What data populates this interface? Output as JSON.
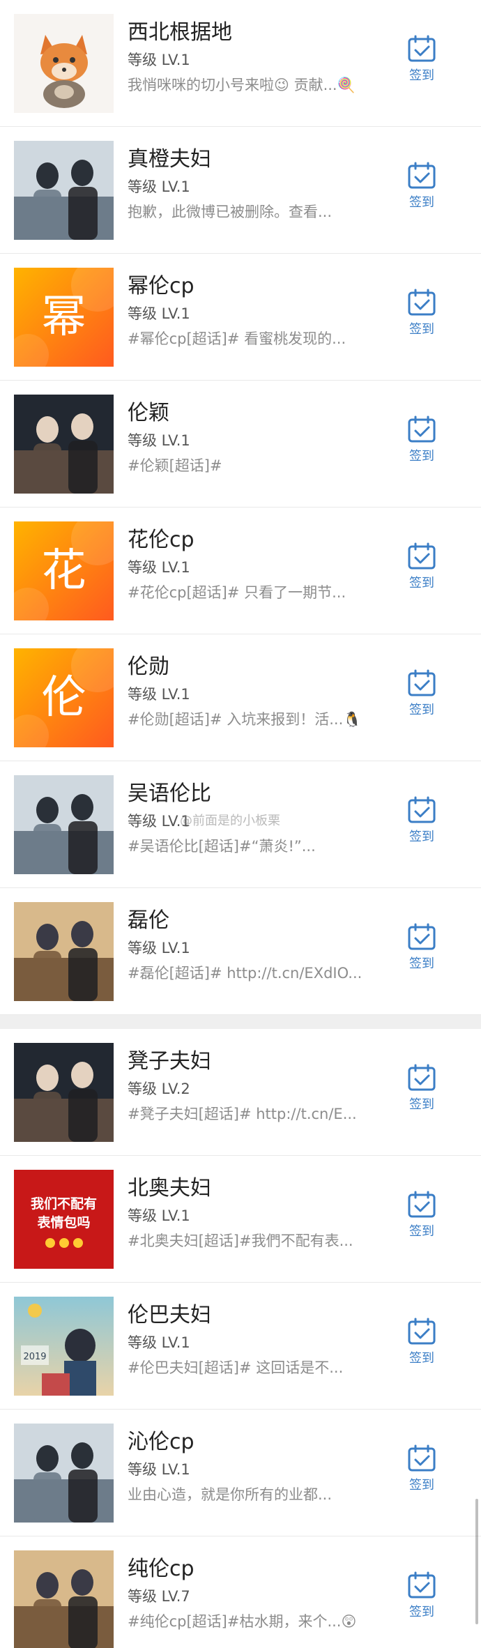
{
  "checkin_label": "签到",
  "watermark": "@前面是的小板栗",
  "icons": {
    "checkin": "calendar-check-icon"
  },
  "colors": {
    "accent": "#3b7ec6",
    "orange": "#f56a1b"
  },
  "groups": [
    [
      {
        "name": "西北根据地",
        "level": "等级 LV.1",
        "desc": "我悄咪咪的切小号来啦😉 贡献...🍭",
        "thumb_kind": "cartoon"
      },
      {
        "name": "真橙夫妇",
        "level": "等级 LV.1",
        "desc": "抱歉，此微博已被删除。查看...",
        "thumb_kind": "photo"
      },
      {
        "name": "幂伦cp",
        "level": "等级 LV.1",
        "desc": "#幂伦cp[超话]# 看蜜桃发现的...",
        "thumb_kind": "char",
        "thumb_char": "幂"
      },
      {
        "name": "伦颖",
        "level": "等级 LV.1",
        "desc": "#伦颖[超话]#",
        "thumb_kind": "photo"
      },
      {
        "name": "花伦cp",
        "level": "等级 LV.1",
        "desc": "#花伦cp[超话]# 只看了一期节...",
        "thumb_kind": "char",
        "thumb_char": "花"
      },
      {
        "name": "伦勋",
        "level": "等级 LV.1",
        "desc": "#伦勋[超话]# 入坑来报到！活...🐧",
        "thumb_kind": "char",
        "thumb_char": "伦"
      },
      {
        "name": "吴语伦比",
        "level": "等级 LV.1",
        "desc": "#吴语伦比[超话]#“萧炎!”...",
        "thumb_kind": "photo"
      },
      {
        "name": "磊伦",
        "level": "等级 LV.1",
        "desc": "#磊伦[超话]# http://t.cn/EXdIO...",
        "thumb_kind": "photo"
      }
    ],
    [
      {
        "name": "凳子夫妇",
        "level": "等级 LV.2",
        "desc": "#凳子夫妇[超话]# http://t.cn/E...",
        "thumb_kind": "photo"
      },
      {
        "name": "北奥夫妇",
        "level": "等级 LV.1",
        "desc": "#北奥夫妇[超话]#我們不配有表...",
        "thumb_kind": "redtext",
        "thumb_lines": [
          "我们不配有",
          "表情包吗"
        ]
      },
      {
        "name": "伦巴夫妇",
        "level": "等级 LV.1",
        "desc": "#伦巴夫妇[超话]# 这回话是不...",
        "thumb_kind": "illus",
        "thumb_lines": [
          "2019"
        ]
      },
      {
        "name": "沁伦cp",
        "level": "等级 LV.1",
        "desc": "业由心造，就是你所有的业都...",
        "thumb_kind": "photo"
      },
      {
        "name": "纯伦cp",
        "level": "等级 LV.7",
        "desc": "#纯伦cp[超话]#枯水期，来个...😲",
        "thumb_kind": "photo"
      }
    ]
  ]
}
